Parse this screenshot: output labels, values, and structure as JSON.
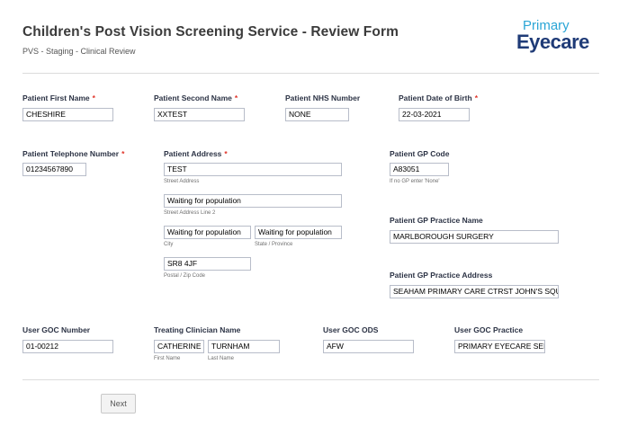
{
  "header": {
    "title": "Children's Post Vision Screening Service - Review Form",
    "subtitle": "PVS - Staging - Clinical Review",
    "logo_top": "Primary",
    "logo_main": "Eyecare"
  },
  "fields": {
    "first_name": {
      "label": "Patient First Name",
      "required": "*",
      "value": "CHESHIRE"
    },
    "second_name": {
      "label": "Patient Second Name",
      "required": "*",
      "value": "XXTEST"
    },
    "nhs_number": {
      "label": "Patient NHS Number",
      "value": "NONE"
    },
    "dob": {
      "label": "Patient Date of Birth",
      "required": "*",
      "value": "22-03-2021"
    },
    "telephone": {
      "label": "Patient Telephone Number",
      "required": "*",
      "value": "01234567890"
    },
    "address": {
      "label": "Patient Address",
      "required": "*",
      "street": "TEST",
      "street_sub": "Street Address",
      "line2": "Waiting for population",
      "line2_sub": "Street Address Line 2",
      "city": "Waiting for population",
      "city_sub": "City",
      "state": "Waiting for population",
      "state_sub": "State / Province",
      "postal": "SR8 4JF",
      "postal_sub": "Postal / Zip Code"
    },
    "gp_code": {
      "label": "Patient GP Code",
      "value": "A83051",
      "sub": "If no GP enter 'None'"
    },
    "gp_practice_name": {
      "label": "Patient GP Practice Name",
      "value": "MARLBOROUGH SURGERY"
    },
    "gp_practice_address": {
      "label": "Patient GP Practice Address",
      "value": "SEAHAM PRIMARY CARE CTRST JOHN'S SQUARE"
    },
    "goc_number": {
      "label": "User GOC Number",
      "value": "01-00212"
    },
    "clinician": {
      "label": "Treating Clinician Name",
      "first": "CATHERINE",
      "first_sub": "First Name",
      "last": "TURNHAM",
      "last_sub": "Last Name"
    },
    "goc_ods": {
      "label": "User GOC ODS",
      "value": "AFW"
    },
    "goc_practice": {
      "label": "User GOC Practice",
      "value": "PRIMARY EYECARE SERVICES"
    }
  },
  "buttons": {
    "next": "Next"
  }
}
